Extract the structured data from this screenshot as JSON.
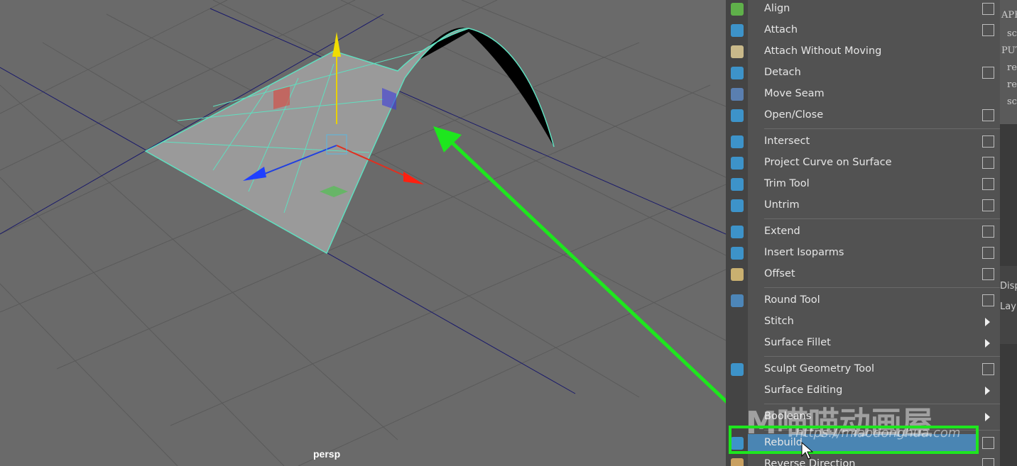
{
  "viewport": {
    "camera_label": "persp"
  },
  "menu": {
    "items": [
      {
        "label": "Align",
        "checkbox": true,
        "submenu": false,
        "icon": "align-icon",
        "color": "#5fb04a"
      },
      {
        "label": "Attach",
        "checkbox": true,
        "submenu": false,
        "icon": "attach-icon",
        "color": "#3d93c9"
      },
      {
        "label": "Attach Without Moving",
        "checkbox": false,
        "submenu": false,
        "icon": "attach-without-moving-icon",
        "color": "#c9b98a"
      },
      {
        "label": "Detach",
        "checkbox": true,
        "submenu": false,
        "icon": "detach-icon",
        "color": "#3d93c9"
      },
      {
        "label": "Move Seam",
        "checkbox": false,
        "submenu": false,
        "icon": "move-seam-icon",
        "color": "#5a7fb0"
      },
      {
        "label": "Open/Close",
        "checkbox": true,
        "submenu": false,
        "icon": "open-close-icon",
        "color": "#3d93c9",
        "sep": true
      },
      {
        "label": "Intersect",
        "checkbox": true,
        "submenu": false,
        "icon": "intersect-icon",
        "color": "#3d93c9"
      },
      {
        "label": "Project Curve on Surface",
        "checkbox": true,
        "submenu": false,
        "icon": "project-curve-icon",
        "color": "#3d93c9"
      },
      {
        "label": "Trim Tool",
        "checkbox": true,
        "submenu": false,
        "icon": "trim-tool-icon",
        "color": "#3d93c9"
      },
      {
        "label": "Untrim",
        "checkbox": true,
        "submenu": false,
        "icon": "untrim-icon",
        "color": "#3d93c9",
        "sep": true
      },
      {
        "label": "Extend",
        "checkbox": true,
        "submenu": false,
        "icon": "extend-icon",
        "color": "#3d93c9"
      },
      {
        "label": "Insert Isoparms",
        "checkbox": true,
        "submenu": false,
        "icon": "insert-isoparms-icon",
        "color": "#3d93c9"
      },
      {
        "label": "Offset",
        "checkbox": true,
        "submenu": false,
        "icon": "offset-icon",
        "color": "#c9b070",
        "sep": true
      },
      {
        "label": "Round Tool",
        "checkbox": true,
        "submenu": false,
        "icon": "round-tool-icon",
        "color": "#4d86b8"
      },
      {
        "label": "Stitch",
        "checkbox": false,
        "submenu": true,
        "icon": "",
        "color": ""
      },
      {
        "label": "Surface Fillet",
        "checkbox": false,
        "submenu": true,
        "icon": "",
        "color": "",
        "sep": true
      },
      {
        "label": "Sculpt Geometry Tool",
        "checkbox": true,
        "submenu": false,
        "icon": "sculpt-geometry-icon",
        "color": "#3d93c9"
      },
      {
        "label": "Surface Editing",
        "checkbox": false,
        "submenu": true,
        "icon": "",
        "color": "",
        "sep": true
      },
      {
        "label": "Booleans",
        "checkbox": false,
        "submenu": true,
        "icon": "",
        "color": "",
        "sep": true
      },
      {
        "label": "Rebuild",
        "checkbox": true,
        "submenu": false,
        "icon": "rebuild-icon",
        "color": "#3d93c9",
        "highlighted": true
      },
      {
        "label": "Reverse Direction",
        "checkbox": true,
        "submenu": false,
        "icon": "reverse-direction-icon",
        "color": "#c9a060"
      }
    ]
  },
  "right_panel": {
    "code_lines": [
      "APE",
      "sc",
      "PUT",
      "re",
      "re",
      "sc"
    ],
    "disp_label": "Disp",
    "layer_label": "Lay"
  },
  "watermark": {
    "text": "M喵喵动画屋",
    "url": "https://miaodonghua.com"
  },
  "colors": {
    "annotation": "#1ee61e",
    "highlight": "#4a85b3",
    "surface_edge": "#5fe0c0"
  }
}
